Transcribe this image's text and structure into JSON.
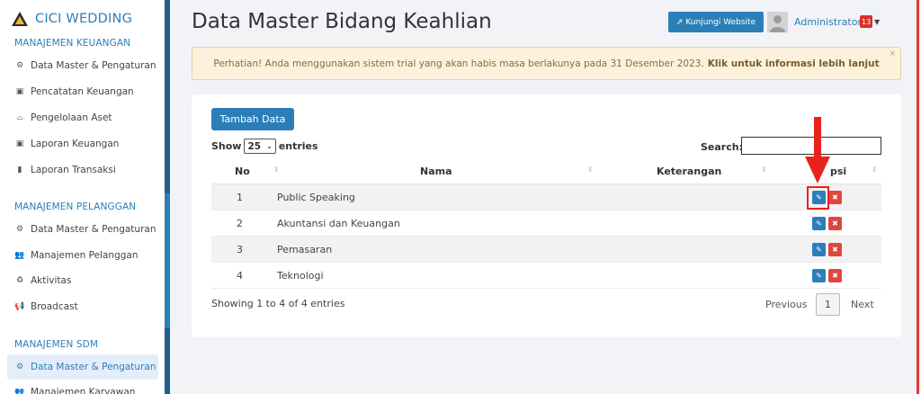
{
  "sidebar": {
    "brand": "CICI WEDDING",
    "sections": {
      "keuangan": {
        "title": "MANAJEMEN KEUANGAN",
        "items": [
          {
            "label": "Data Master & Pengaturan",
            "icon": "gears-icon"
          },
          {
            "label": "Pencatatan Keuangan",
            "icon": "money-icon"
          },
          {
            "label": "Pengelolaan Aset",
            "icon": "hdd-icon"
          },
          {
            "label": "Laporan Keuangan",
            "icon": "money-icon"
          },
          {
            "label": "Laporan Transaksi",
            "icon": "book-icon"
          }
        ]
      },
      "pelanggan": {
        "title": "MANAJEMEN PELANGGAN",
        "items": [
          {
            "label": "Data Master & Pengaturan",
            "icon": "gears-icon"
          },
          {
            "label": "Manajemen Pelanggan",
            "icon": "users-icon"
          },
          {
            "label": "Aktivitas",
            "icon": "recycle-icon"
          },
          {
            "label": "Broadcast",
            "icon": "bullhorn-icon"
          }
        ]
      },
      "sdm": {
        "title": "MANAJEMEN SDM",
        "items": [
          {
            "label": "Data Master & Pengaturan",
            "icon": "gears-icon",
            "active": true
          },
          {
            "label": "Manajemen Karyawan",
            "icon": "users-icon"
          }
        ]
      }
    }
  },
  "header": {
    "title": "Data Master Bidang Keahlian",
    "visit_label": "Kunjungi Website",
    "user_name": "Administrator",
    "notif_count": "13"
  },
  "alert": {
    "text": "Perhatian! Anda menggunakan sistem trial yang akan habis masa berlakunya pada 31 Desember 2023.",
    "link": "Klik untuk informasi lebih lanjut",
    "close": "×"
  },
  "table": {
    "add_label": "Tambah Data",
    "show_label": "Show",
    "page_size": "25",
    "entries_label": "entries",
    "search_label": "Search:",
    "columns": [
      "No",
      "Nama",
      "Keterangan",
      "psi"
    ],
    "rows": [
      {
        "no": "1",
        "nama": "Public Speaking"
      },
      {
        "no": "2",
        "nama": "Akuntansi dan Keuangan"
      },
      {
        "no": "3",
        "nama": "Pemasaran"
      },
      {
        "no": "4",
        "nama": "Teknologi"
      }
    ],
    "info": "Showing 1 to 4 of 4 entries",
    "pagination": {
      "prev": "Previous",
      "page": "1",
      "next": "Next"
    }
  },
  "colors": {
    "primary": "#2b7fb8",
    "danger": "#e0463f",
    "alert_bg": "#fcf1db",
    "annotation": "#e8231d"
  }
}
